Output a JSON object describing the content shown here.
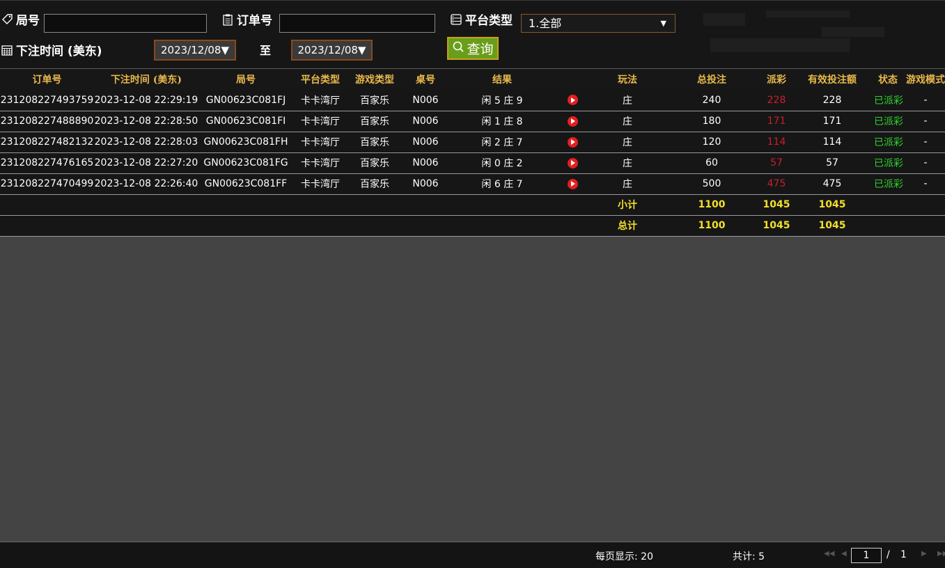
{
  "filters": {
    "round_label": "局号",
    "round_value": "",
    "order_label": "订单号",
    "order_value": "",
    "platform_label": "平台类型",
    "platform_selected": "1.全部",
    "bet_time_label": "下注时间 (美东)",
    "date_from": "2023/12/08▼",
    "to_label": "至",
    "date_to": "2023/12/08▼",
    "query_label": "查询"
  },
  "table": {
    "headers": [
      "订单号",
      "下注时间 (美东)",
      "局号",
      "平台类型",
      "游戏类型",
      "桌号",
      "结果",
      "",
      "玩法",
      "总投注",
      "派彩",
      "有效投注额",
      "状态",
      "游戏模式"
    ],
    "rows": [
      {
        "order": "231208227493759",
        "time": "2023-12-08 22:29:19",
        "round": "GN00623C081FJ",
        "platform": "卡卡湾厅",
        "game": "百家乐",
        "table": "N006",
        "result": "闲 5 庄 9",
        "play": "庄",
        "bet": "240",
        "payout": "228",
        "valid": "228",
        "status": "已派彩",
        "mode": "-"
      },
      {
        "order": "231208227488890",
        "time": "2023-12-08 22:28:50",
        "round": "GN00623C081FI",
        "platform": "卡卡湾厅",
        "game": "百家乐",
        "table": "N006",
        "result": "闲 1 庄 8",
        "play": "庄",
        "bet": "180",
        "payout": "171",
        "valid": "171",
        "status": "已派彩",
        "mode": "-"
      },
      {
        "order": "231208227482132",
        "time": "2023-12-08 22:28:03",
        "round": "GN00623C081FH",
        "platform": "卡卡湾厅",
        "game": "百家乐",
        "table": "N006",
        "result": "闲 2 庄 7",
        "play": "庄",
        "bet": "120",
        "payout": "114",
        "valid": "114",
        "status": "已派彩",
        "mode": "-"
      },
      {
        "order": "231208227476165",
        "time": "2023-12-08 22:27:20",
        "round": "GN00623C081FG",
        "platform": "卡卡湾厅",
        "game": "百家乐",
        "table": "N006",
        "result": "闲 0 庄 2",
        "play": "庄",
        "bet": "60",
        "payout": "57",
        "valid": "57",
        "status": "已派彩",
        "mode": "-"
      },
      {
        "order": "231208227470499",
        "time": "2023-12-08 22:26:40",
        "round": "GN00623C081FF",
        "platform": "卡卡湾厅",
        "game": "百家乐",
        "table": "N006",
        "result": "闲 6 庄 7",
        "play": "庄",
        "bet": "500",
        "payout": "475",
        "valid": "475",
        "status": "已派彩",
        "mode": "-"
      }
    ],
    "subtotal": {
      "label": "小计",
      "bet": "1100",
      "payout": "1045",
      "valid": "1045"
    },
    "total": {
      "label": "总计",
      "bet": "1100",
      "payout": "1045",
      "valid": "1045"
    }
  },
  "footer": {
    "per_page": "每页显示: 20",
    "total_count": "共计: 5",
    "current_page": "1",
    "page_sep": "/",
    "total_pages": "1"
  },
  "colors": {
    "header_text": "#e8b84a",
    "payout_red": "#c8202a",
    "status_green": "#2ed42e",
    "summary_yellow": "#f2e02a",
    "query_green": "#6a9e1a"
  },
  "icons": [
    "tag-icon",
    "clipboard-icon",
    "list-icon",
    "calendar-icon",
    "search-icon",
    "play-icon"
  ]
}
